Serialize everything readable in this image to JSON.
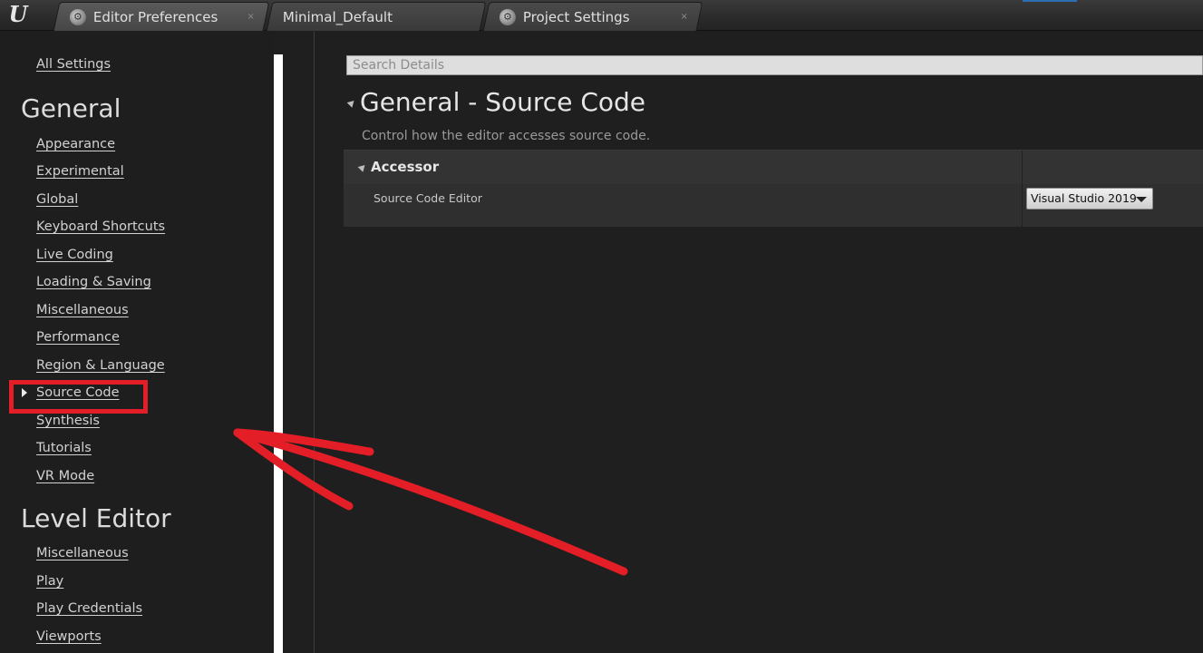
{
  "tabs": [
    {
      "label": "Editor Preferences",
      "icon": "editor-preferences-icon",
      "close": "×"
    },
    {
      "label": "Minimal_Default"
    },
    {
      "label": "Project Settings",
      "icon": "project-settings-icon",
      "close": "×"
    }
  ],
  "sidebar": {
    "all_settings": "All Settings",
    "general_heading": "General",
    "general_items": [
      "Appearance",
      "Experimental",
      "Global",
      "Keyboard Shortcuts",
      "Live Coding",
      "Loading & Saving",
      "Miscellaneous",
      "Performance",
      "Region & Language",
      "Source Code",
      "Synthesis",
      "Tutorials",
      "VR Mode"
    ],
    "selected_item": "Source Code",
    "level_editor_heading": "Level Editor",
    "level_editor_items": [
      "Miscellaneous",
      "Play",
      "Play Credentials",
      "Viewports"
    ]
  },
  "details": {
    "search_placeholder": "Search Details",
    "title": "General - Source Code",
    "description": "Control how the editor accesses source code.",
    "group_title": "Accessor",
    "property_label": "Source Code Editor",
    "property_value": "Visual Studio 2019"
  },
  "colors": {
    "annotation_red": "#e41e26",
    "background": "#1f1f1f",
    "accent_blue": "#2e6fb3"
  }
}
